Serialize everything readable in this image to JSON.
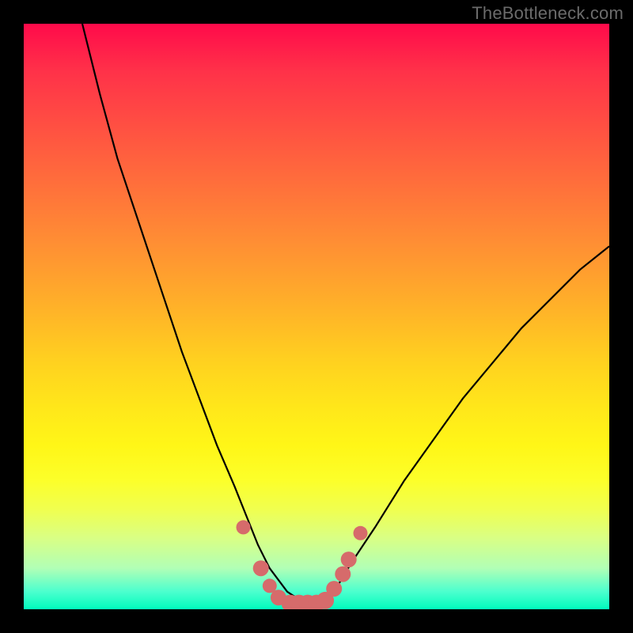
{
  "watermark": "TheBottleneck.com",
  "chart_data": {
    "type": "line",
    "title": "",
    "xlabel": "",
    "ylabel": "",
    "xlim": [
      0,
      100
    ],
    "ylim": [
      0,
      100
    ],
    "series": [
      {
        "name": "curve",
        "x": [
          10,
          13,
          16,
          20,
          24,
          27,
          30,
          33,
          36,
          38,
          40,
          42,
          45,
          48,
          50,
          53,
          56,
          60,
          65,
          70,
          75,
          80,
          85,
          90,
          95,
          100
        ],
        "y": [
          100,
          88,
          77,
          65,
          53,
          44,
          36,
          28,
          21,
          16,
          11,
          7,
          3,
          1,
          1,
          3,
          8,
          14,
          22,
          29,
          36,
          42,
          48,
          53,
          58,
          62
        ]
      }
    ],
    "markers": {
      "name": "highlight-dots",
      "color": "#d66b6b",
      "x": [
        37.5,
        40.5,
        42,
        43.5,
        45.5,
        47,
        48.5,
        50,
        51.5,
        53,
        54.5,
        55.5,
        57.5
      ],
      "y": [
        14,
        7,
        4,
        2,
        1,
        1,
        1,
        1,
        1.5,
        3.5,
        6,
        8.5,
        13
      ],
      "r": [
        9,
        10,
        9,
        10,
        11,
        11,
        11,
        11,
        11,
        10,
        10,
        10,
        9
      ]
    }
  }
}
